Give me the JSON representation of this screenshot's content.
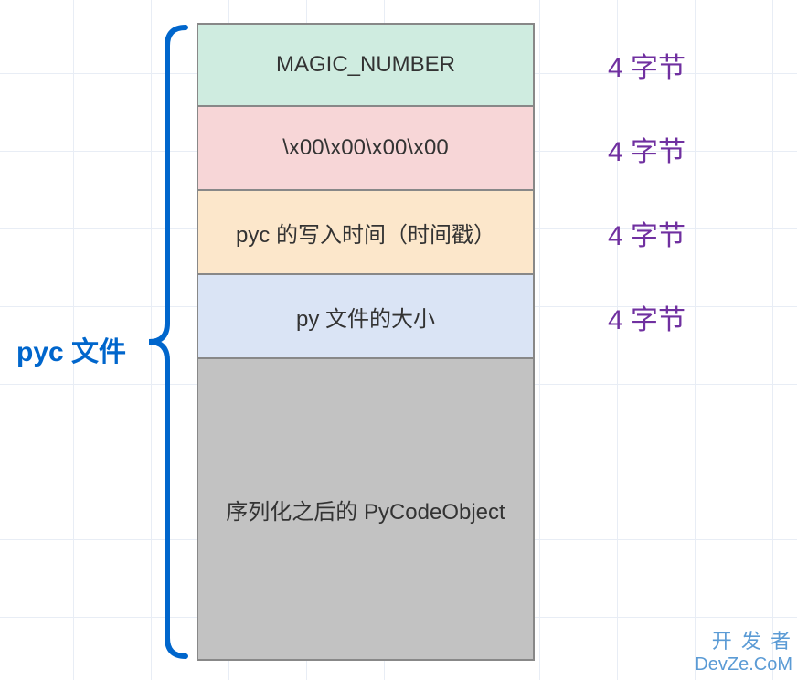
{
  "title_label": "pyc 文件",
  "rows": [
    {
      "text": "MAGIC_NUMBER",
      "size": "4 字节"
    },
    {
      "text": "\\x00\\x00\\x00\\x00",
      "size": "4 字节"
    },
    {
      "text": "pyc 的写入时间（时间戳）",
      "size": "4 字节"
    },
    {
      "text": "py 文件的大小",
      "size": "4 字节"
    },
    {
      "text": "序列化之后的 PyCodeObject",
      "size": ""
    }
  ],
  "watermark": {
    "line1": "开 发 者",
    "line2": "DevZe.CoM"
  }
}
